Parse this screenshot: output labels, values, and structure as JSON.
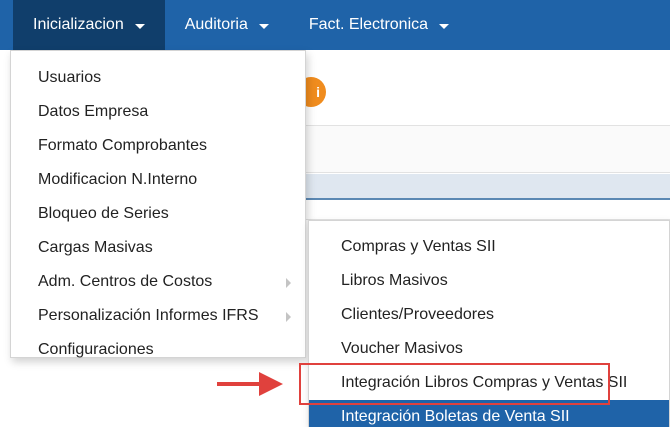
{
  "navbar": {
    "items": [
      {
        "label": "Inicializacion",
        "active": true
      },
      {
        "label": "Auditoria",
        "active": false
      },
      {
        "label": "Fact. Electronica",
        "active": false
      }
    ]
  },
  "background": {
    "button_glyph": "i"
  },
  "dropdown": {
    "items": [
      {
        "label": "Usuarios"
      },
      {
        "label": "Datos Empresa"
      },
      {
        "label": "Formato Comprobantes"
      },
      {
        "label": "Modificacion N.Interno"
      },
      {
        "label": "Bloqueo de Series"
      },
      {
        "label": "Cargas Masivas"
      },
      {
        "label": "Adm. Centros de Costos"
      },
      {
        "label": "Personalización Informes IFRS"
      },
      {
        "label": "Configuraciones"
      }
    ]
  },
  "submenu": {
    "items": [
      {
        "label": "Compras y Ventas SII"
      },
      {
        "label": "Libros Masivos"
      },
      {
        "label": "Clientes/Proveedores"
      },
      {
        "label": "Voucher Masivos"
      },
      {
        "label": "Integración Libros Compras y Ventas SII"
      },
      {
        "label": "Integración Boletas de Venta SII"
      }
    ]
  },
  "colors": {
    "navbar": "#1f63a8",
    "navbar_active": "#103e6b",
    "selected_item": "#1f63a8",
    "annotation": "#e0413d",
    "orange_button": "#f08c1e"
  }
}
